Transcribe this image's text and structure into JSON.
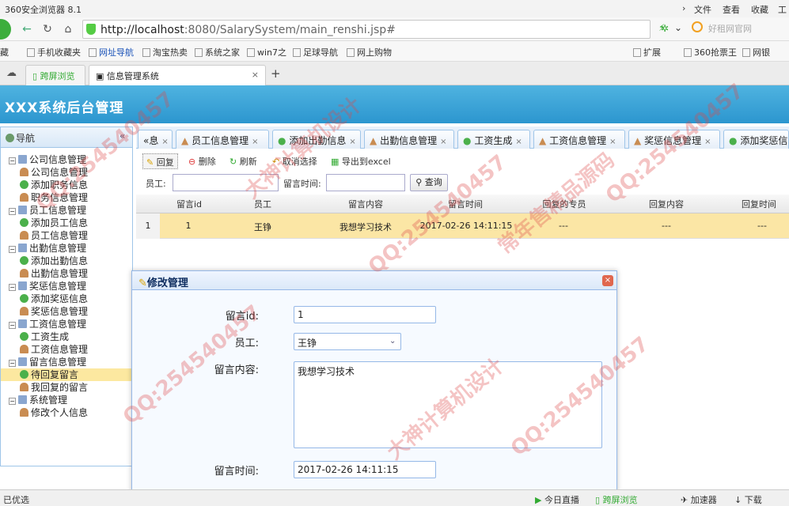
{
  "browser": {
    "title": "360安全浏览器 8.1",
    "menu": [
      "文件",
      "查看",
      "收藏",
      "工具"
    ],
    "url_host": "http://localhost",
    "url_rest": ":8080/SalarySystem/main_renshi.jsp#",
    "search_placeholder": "好租网官网",
    "bookmarks": [
      "藏",
      "手机收藏夹",
      "网址导航",
      "淘宝热卖",
      "系统之家",
      "win7之",
      "足球导航",
      "网上购物",
      "扩展",
      "360抢票王",
      "网银"
    ],
    "tabs": [
      "跨屏浏览",
      "信息管理系统"
    ],
    "new_tab": "+"
  },
  "app": {
    "title": "XXX系统后台管理"
  },
  "sidebar": {
    "title": "导航",
    "collapse": "«",
    "items": [
      {
        "label": "公司信息管理",
        "level": 0,
        "icon": "folder"
      },
      {
        "label": "公司信息管理",
        "level": 1,
        "icon": "person"
      },
      {
        "label": "添加职务信息",
        "level": 1,
        "icon": "plus"
      },
      {
        "label": "职务信息管理",
        "level": 1,
        "icon": "person"
      },
      {
        "label": "员工信息管理",
        "level": 0,
        "icon": "folder"
      },
      {
        "label": "添加员工信息",
        "level": 1,
        "icon": "plus"
      },
      {
        "label": "员工信息管理",
        "level": 1,
        "icon": "person"
      },
      {
        "label": "出勤信息管理",
        "level": 0,
        "icon": "folder"
      },
      {
        "label": "添加出勤信息",
        "level": 1,
        "icon": "plus"
      },
      {
        "label": "出勤信息管理",
        "level": 1,
        "icon": "person"
      },
      {
        "label": "奖惩信息管理",
        "level": 0,
        "icon": "folder"
      },
      {
        "label": "添加奖惩信息",
        "level": 1,
        "icon": "plus"
      },
      {
        "label": "奖惩信息管理",
        "level": 1,
        "icon": "person"
      },
      {
        "label": "工资信息管理",
        "level": 0,
        "icon": "folder"
      },
      {
        "label": "工资生成",
        "level": 1,
        "icon": "plus"
      },
      {
        "label": "工资信息管理",
        "level": 1,
        "icon": "person"
      },
      {
        "label": "留言信息管理",
        "level": 0,
        "icon": "folder"
      },
      {
        "label": "待回复留言",
        "level": 1,
        "icon": "plus"
      },
      {
        "label": "我回复的留言",
        "level": 1,
        "icon": "person"
      },
      {
        "label": "系统管理",
        "level": 0,
        "icon": "folder"
      },
      {
        "label": "修改个人信息",
        "level": 1,
        "icon": "person"
      }
    ]
  },
  "main_tabs": [
    "«息",
    "员工信息管理",
    "添加出勤信息",
    "出勤信息管理",
    "工资生成",
    "工资信息管理",
    "奖惩信息管理",
    "添加奖惩信"
  ],
  "toolbar": {
    "reply": "回复",
    "delete": "删除",
    "refresh": "刷新",
    "cancel_select": "取消选择",
    "export": "导出到excel"
  },
  "filters": {
    "employee_label": "员工:",
    "time_label": "留言时间:",
    "search": "查询"
  },
  "grid": {
    "headers": [
      "留言id",
      "员工",
      "留言内容",
      "留言时间",
      "回复的专员",
      "回复内容",
      "回复时间"
    ],
    "rows": [
      {
        "num": "1",
        "id": "1",
        "employee": "王铮",
        "content": "我想学习技术",
        "time": "2017-02-26 14:11:15",
        "replier": "---",
        "reply": "---",
        "reply_time": "---"
      }
    ]
  },
  "dialog": {
    "title": "修改管理",
    "close": "×",
    "id_label": "留言id:",
    "id_value": "1",
    "employee_label": "员工:",
    "employee_value": "王铮",
    "content_label": "留言内容:",
    "content_value": "我想学习技术",
    "time_label": "留言时间:",
    "time_value": "2017-02-26 14:11:15"
  },
  "statusbar": {
    "left": "已优选",
    "items": [
      "今日直播",
      "跨屏浏览",
      "加速器",
      "下载"
    ]
  },
  "watermarks": [
    "QQ:254540457",
    "大神计算机设计",
    "常年售精品源码"
  ]
}
